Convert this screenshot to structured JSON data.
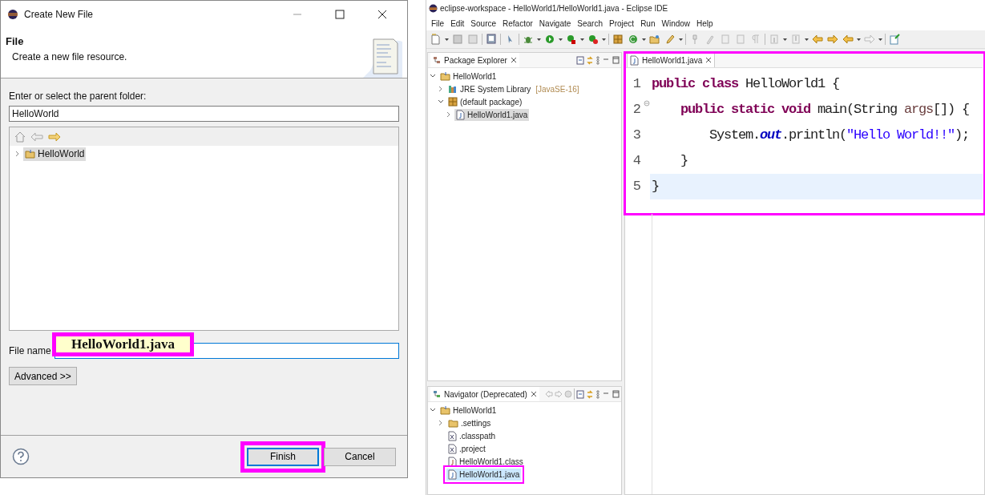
{
  "dialog": {
    "title": "Create New File",
    "header": {
      "title": "File",
      "description": "Create a new file resource."
    },
    "folder_label": "Enter or select the parent folder:",
    "folder_value": "HelloWorld",
    "folder_tree": [
      {
        "label": "HelloWorld",
        "kind": "project",
        "expanded": false,
        "selected": true
      }
    ],
    "file_name": {
      "label": "File name",
      "callout": {
        "text": "HelloWorld1.java",
        "highlighted": true
      }
    },
    "advanced_button": "Advanced >>",
    "buttons": [
      {
        "label": "Finish",
        "default": true,
        "highlighted": true
      },
      {
        "label": "Cancel",
        "default": false,
        "highlighted": false
      }
    ]
  },
  "ide": {
    "title": "eclipse-workspace - HelloWorld1/HelloWorld1.java - Eclipse IDE",
    "menu": [
      "File",
      "Edit",
      "Source",
      "Refactor",
      "Navigate",
      "Search",
      "Project",
      "Run",
      "Window",
      "Help"
    ],
    "package_explorer": {
      "tab": "Package Explorer",
      "tree": [
        {
          "label": "HelloWorld1",
          "kind": "project",
          "expanded": true,
          "selected": false,
          "highlighted": false,
          "children": [
            {
              "label": "JRE System Library",
              "decoration": "[JavaSE-16]",
              "kind": "library",
              "expanded": false,
              "selected": false,
              "highlighted": false
            },
            {
              "label": "(default package)",
              "kind": "package",
              "expanded": true,
              "selected": false,
              "highlighted": false,
              "children": [
                {
                  "label": "HelloWorld1.java",
                  "kind": "java",
                  "expanded": false,
                  "selected": true,
                  "highlighted": false
                }
              ]
            }
          ]
        }
      ]
    },
    "navigator": {
      "tab": "Navigator (Deprecated)",
      "tree": [
        {
          "label": "HelloWorld1",
          "kind": "project",
          "expanded": true,
          "selected": false,
          "highlighted": false,
          "children": [
            {
              "label": ".settings",
              "kind": "folder",
              "expanded": false,
              "selected": false,
              "highlighted": false
            },
            {
              "label": ".classpath",
              "kind": "xml",
              "selected": false,
              "highlighted": false
            },
            {
              "label": ".project",
              "kind": "xml",
              "selected": false,
              "highlighted": false
            },
            {
              "label": "HelloWorld1.class",
              "kind": "class",
              "selected": false,
              "highlighted": false
            },
            {
              "label": "HelloWorld1.java",
              "kind": "java",
              "selected": true,
              "highlighted": true
            }
          ]
        }
      ]
    },
    "editor": {
      "tab": "HelloWorld1.java",
      "highlighted": true,
      "lines": [
        {
          "number": "1",
          "current": false,
          "fold": false,
          "tokens": [
            {
              "text": "public class",
              "kind": "keyword"
            },
            {
              "text": " HelloWorld1 {",
              "kind": "plain"
            }
          ]
        },
        {
          "number": "2",
          "current": false,
          "fold": true,
          "tokens": [
            {
              "text": "    public static void",
              "kind": "keyword"
            },
            {
              "text": " main(String ",
              "kind": "plain"
            },
            {
              "text": "args",
              "kind": "param"
            },
            {
              "text": "[]) {",
              "kind": "plain"
            }
          ]
        },
        {
          "number": "3",
          "current": false,
          "fold": false,
          "tokens": [
            {
              "text": "        System.",
              "kind": "plain"
            },
            {
              "text": "out",
              "kind": "field"
            },
            {
              "text": ".println(",
              "kind": "plain"
            },
            {
              "text": "\"Hello World!!\"",
              "kind": "string"
            },
            {
              "text": ");",
              "kind": "plain"
            }
          ]
        },
        {
          "number": "4",
          "current": false,
          "fold": false,
          "tokens": [
            {
              "text": "    }",
              "kind": "plain"
            }
          ]
        },
        {
          "number": "5",
          "current": true,
          "fold": false,
          "tokens": [
            {
              "text": "}",
              "kind": "plain"
            }
          ]
        }
      ]
    }
  }
}
